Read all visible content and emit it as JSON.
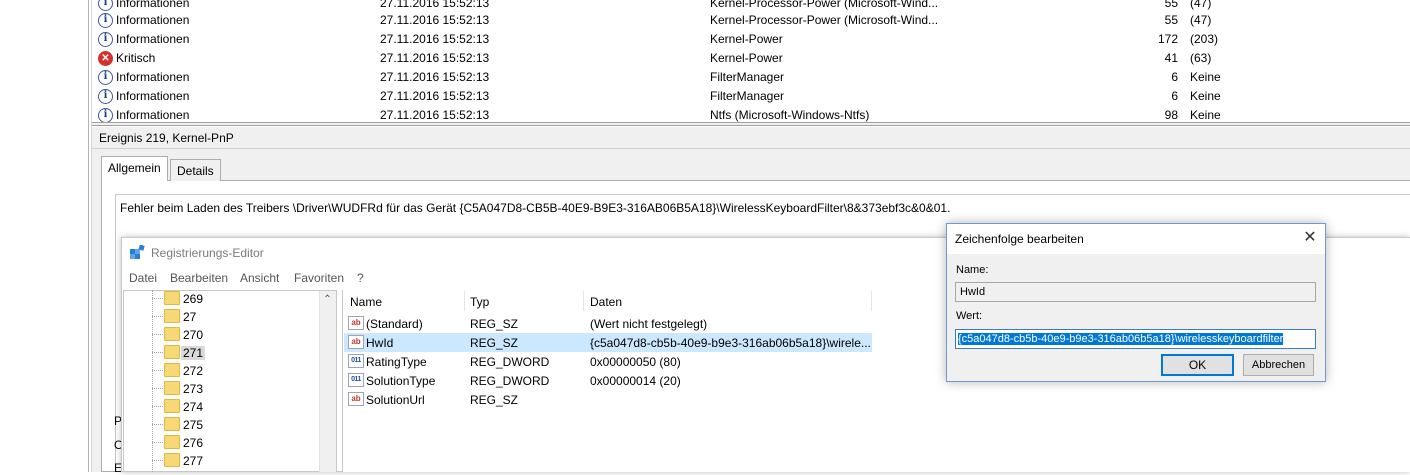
{
  "events": [
    {
      "level": "Informationen",
      "date": "27.11.2016 15:52:13",
      "source": "Kernel-Processor-Power (Microsoft-Wind...",
      "id": "55",
      "task": "(47)",
      "icon": "info-icon"
    },
    {
      "level": "Informationen",
      "date": "27.11.2016 15:52:13",
      "source": "Kernel-Processor-Power (Microsoft-Wind...",
      "id": "55",
      "task": "(47)",
      "icon": "info-icon"
    },
    {
      "level": "Informationen",
      "date": "27.11.2016 15:52:13",
      "source": "Kernel-Power",
      "id": "172",
      "task": "(203)",
      "icon": "info-icon"
    },
    {
      "level": "Kritisch",
      "date": "27.11.2016 15:52:13",
      "source": "Kernel-Power",
      "id": "41",
      "task": "(63)",
      "icon": "critical-icon"
    },
    {
      "level": "Informationen",
      "date": "27.11.2016 15:52:13",
      "source": "FilterManager",
      "id": "6",
      "task": "Keine",
      "icon": "info-icon"
    },
    {
      "level": "Informationen",
      "date": "27.11.2016 15:52:13",
      "source": "FilterManager",
      "id": "6",
      "task": "Keine",
      "icon": "info-icon"
    },
    {
      "level": "Informationen",
      "date": "27.11.2016 15:52:13",
      "source": "Ntfs (Microsoft-Windows-Ntfs)",
      "id": "98",
      "task": "Keine",
      "icon": "info-icon"
    }
  ],
  "detail": {
    "header": "Ereignis 219, Kernel-PnP",
    "tab_general": "Allgemein",
    "tab_details": "Details",
    "description": "Fehler beim Laden des Treibers \\Driver\\WUDFRd für das Gerät {C5A047D8-CB5B-40E9-B9E3-316AB06B5A18}\\WirelessKeyboardFilter\\8&373ebf3c&0&01.",
    "cut_letters": [
      "P",
      "O",
      "E"
    ]
  },
  "regedit": {
    "title": "Registrierungs-Editor",
    "menu": [
      "Datei",
      "Bearbeiten",
      "Ansicht",
      "Favoriten",
      "?"
    ],
    "tree": [
      "269",
      "27",
      "270",
      "271",
      "272",
      "273",
      "274",
      "275",
      "276",
      "277"
    ],
    "columns": {
      "name": "Name",
      "type": "Typ",
      "data": "Daten"
    },
    "values": [
      {
        "name": "(Standard)",
        "type": "REG_SZ",
        "data": "(Wert nicht festgelegt)",
        "icon": "string-value-icon"
      },
      {
        "name": "HwId",
        "type": "REG_SZ",
        "data": "{c5a047d8-cb5b-40e9-b9e3-316ab06b5a18}\\wirele...",
        "icon": "string-value-icon"
      },
      {
        "name": "RatingType",
        "type": "REG_DWORD",
        "data": "0x00000050 (80)",
        "icon": "binary-value-icon"
      },
      {
        "name": "SolutionType",
        "type": "REG_DWORD",
        "data": "0x00000014 (20)",
        "icon": "binary-value-icon"
      },
      {
        "name": "SolutionUrl",
        "type": "REG_SZ",
        "data": "",
        "icon": "string-value-icon"
      }
    ]
  },
  "dialog": {
    "title": "Zeichenfolge bearbeiten",
    "name_label": "Name:",
    "name_value": "HwId",
    "value_label": "Wert:",
    "value_value": "{c5a047d8-cb5b-40e9-b9e3-316ab06b5a18}\\wirelesskeyboardfilter",
    "ok_label": "OK",
    "cancel_label": "Abbrechen"
  }
}
